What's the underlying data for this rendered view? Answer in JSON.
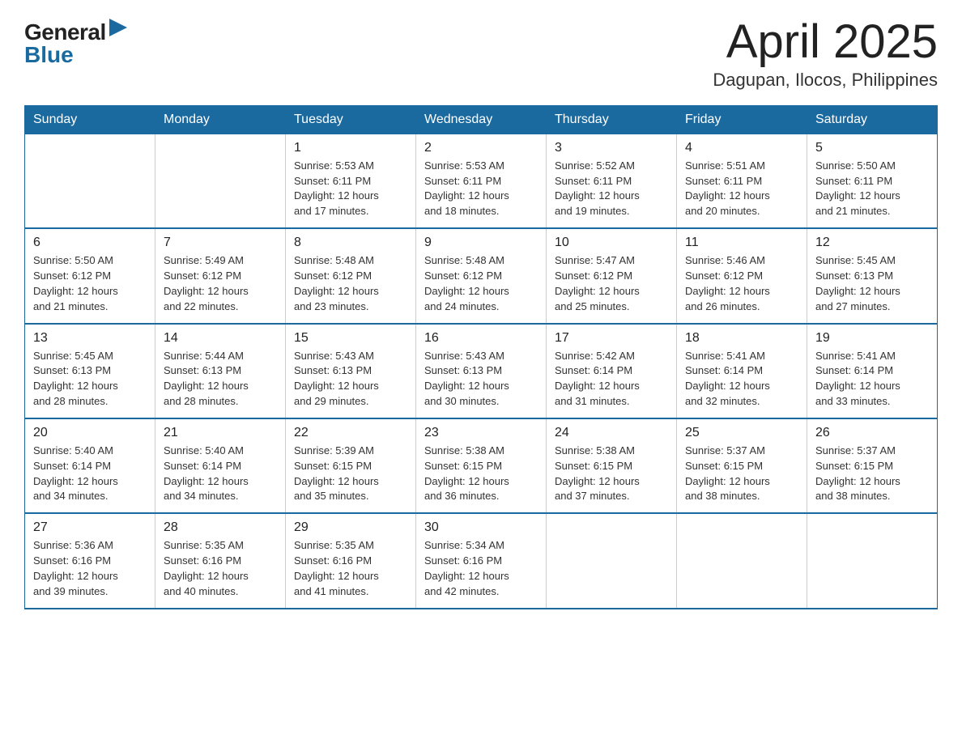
{
  "header": {
    "logo_general": "General",
    "logo_blue": "Blue",
    "title": "April 2025",
    "location": "Dagupan, Ilocos, Philippines"
  },
  "weekdays": [
    "Sunday",
    "Monday",
    "Tuesday",
    "Wednesday",
    "Thursday",
    "Friday",
    "Saturday"
  ],
  "weeks": [
    [
      {
        "day": "",
        "info": ""
      },
      {
        "day": "",
        "info": ""
      },
      {
        "day": "1",
        "info": "Sunrise: 5:53 AM\nSunset: 6:11 PM\nDaylight: 12 hours\nand 17 minutes."
      },
      {
        "day": "2",
        "info": "Sunrise: 5:53 AM\nSunset: 6:11 PM\nDaylight: 12 hours\nand 18 minutes."
      },
      {
        "day": "3",
        "info": "Sunrise: 5:52 AM\nSunset: 6:11 PM\nDaylight: 12 hours\nand 19 minutes."
      },
      {
        "day": "4",
        "info": "Sunrise: 5:51 AM\nSunset: 6:11 PM\nDaylight: 12 hours\nand 20 minutes."
      },
      {
        "day": "5",
        "info": "Sunrise: 5:50 AM\nSunset: 6:11 PM\nDaylight: 12 hours\nand 21 minutes."
      }
    ],
    [
      {
        "day": "6",
        "info": "Sunrise: 5:50 AM\nSunset: 6:12 PM\nDaylight: 12 hours\nand 21 minutes."
      },
      {
        "day": "7",
        "info": "Sunrise: 5:49 AM\nSunset: 6:12 PM\nDaylight: 12 hours\nand 22 minutes."
      },
      {
        "day": "8",
        "info": "Sunrise: 5:48 AM\nSunset: 6:12 PM\nDaylight: 12 hours\nand 23 minutes."
      },
      {
        "day": "9",
        "info": "Sunrise: 5:48 AM\nSunset: 6:12 PM\nDaylight: 12 hours\nand 24 minutes."
      },
      {
        "day": "10",
        "info": "Sunrise: 5:47 AM\nSunset: 6:12 PM\nDaylight: 12 hours\nand 25 minutes."
      },
      {
        "day": "11",
        "info": "Sunrise: 5:46 AM\nSunset: 6:12 PM\nDaylight: 12 hours\nand 26 minutes."
      },
      {
        "day": "12",
        "info": "Sunrise: 5:45 AM\nSunset: 6:13 PM\nDaylight: 12 hours\nand 27 minutes."
      }
    ],
    [
      {
        "day": "13",
        "info": "Sunrise: 5:45 AM\nSunset: 6:13 PM\nDaylight: 12 hours\nand 28 minutes."
      },
      {
        "day": "14",
        "info": "Sunrise: 5:44 AM\nSunset: 6:13 PM\nDaylight: 12 hours\nand 28 minutes."
      },
      {
        "day": "15",
        "info": "Sunrise: 5:43 AM\nSunset: 6:13 PM\nDaylight: 12 hours\nand 29 minutes."
      },
      {
        "day": "16",
        "info": "Sunrise: 5:43 AM\nSunset: 6:13 PM\nDaylight: 12 hours\nand 30 minutes."
      },
      {
        "day": "17",
        "info": "Sunrise: 5:42 AM\nSunset: 6:14 PM\nDaylight: 12 hours\nand 31 minutes."
      },
      {
        "day": "18",
        "info": "Sunrise: 5:41 AM\nSunset: 6:14 PM\nDaylight: 12 hours\nand 32 minutes."
      },
      {
        "day": "19",
        "info": "Sunrise: 5:41 AM\nSunset: 6:14 PM\nDaylight: 12 hours\nand 33 minutes."
      }
    ],
    [
      {
        "day": "20",
        "info": "Sunrise: 5:40 AM\nSunset: 6:14 PM\nDaylight: 12 hours\nand 34 minutes."
      },
      {
        "day": "21",
        "info": "Sunrise: 5:40 AM\nSunset: 6:14 PM\nDaylight: 12 hours\nand 34 minutes."
      },
      {
        "day": "22",
        "info": "Sunrise: 5:39 AM\nSunset: 6:15 PM\nDaylight: 12 hours\nand 35 minutes."
      },
      {
        "day": "23",
        "info": "Sunrise: 5:38 AM\nSunset: 6:15 PM\nDaylight: 12 hours\nand 36 minutes."
      },
      {
        "day": "24",
        "info": "Sunrise: 5:38 AM\nSunset: 6:15 PM\nDaylight: 12 hours\nand 37 minutes."
      },
      {
        "day": "25",
        "info": "Sunrise: 5:37 AM\nSunset: 6:15 PM\nDaylight: 12 hours\nand 38 minutes."
      },
      {
        "day": "26",
        "info": "Sunrise: 5:37 AM\nSunset: 6:15 PM\nDaylight: 12 hours\nand 38 minutes."
      }
    ],
    [
      {
        "day": "27",
        "info": "Sunrise: 5:36 AM\nSunset: 6:16 PM\nDaylight: 12 hours\nand 39 minutes."
      },
      {
        "day": "28",
        "info": "Sunrise: 5:35 AM\nSunset: 6:16 PM\nDaylight: 12 hours\nand 40 minutes."
      },
      {
        "day": "29",
        "info": "Sunrise: 5:35 AM\nSunset: 6:16 PM\nDaylight: 12 hours\nand 41 minutes."
      },
      {
        "day": "30",
        "info": "Sunrise: 5:34 AM\nSunset: 6:16 PM\nDaylight: 12 hours\nand 42 minutes."
      },
      {
        "day": "",
        "info": ""
      },
      {
        "day": "",
        "info": ""
      },
      {
        "day": "",
        "info": ""
      }
    ]
  ]
}
